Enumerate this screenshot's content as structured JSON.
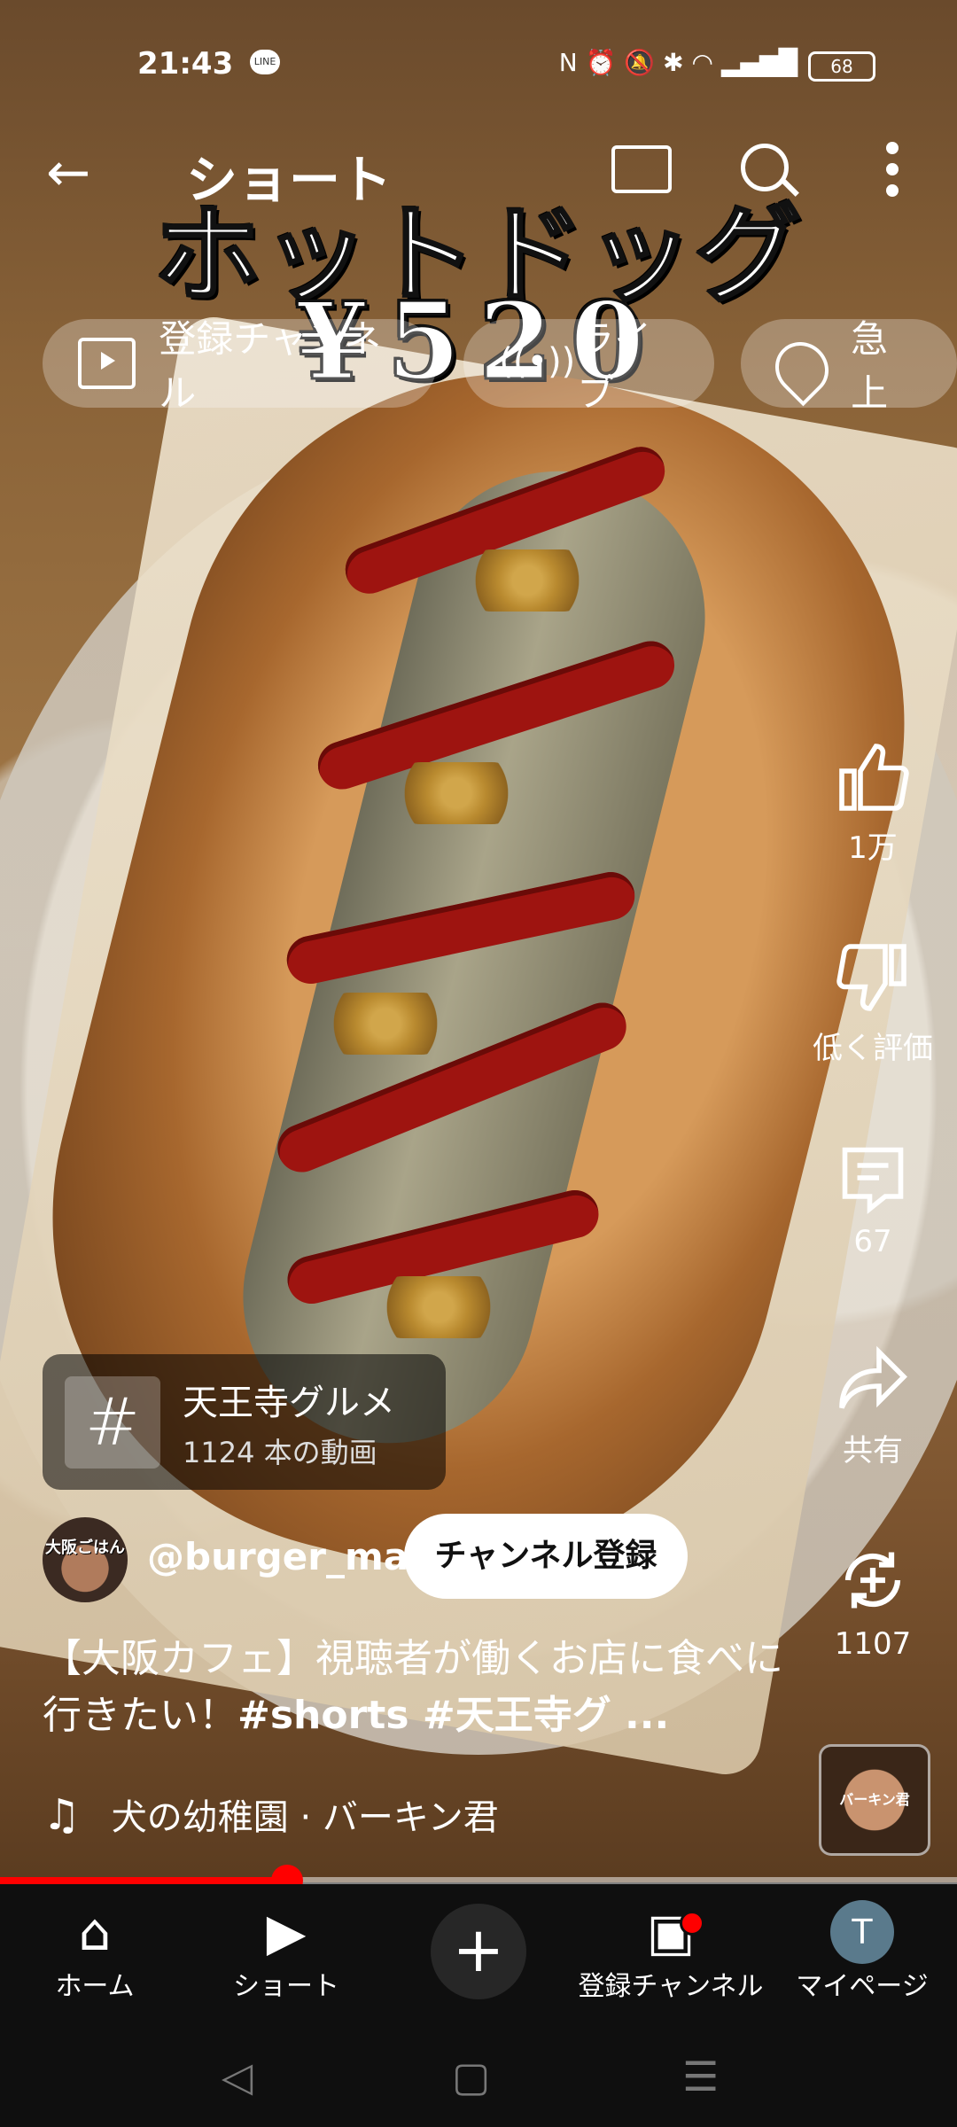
{
  "status": {
    "time": "21:43",
    "line_badge": "LINE",
    "battery": "68"
  },
  "appbar": {
    "title": "ショート"
  },
  "overlay": {
    "line1": "ホットドッグ",
    "line2": "¥520"
  },
  "chips": [
    {
      "label": "登録チャンネル",
      "icon": "subscriptions-icon"
    },
    {
      "label": "ライブ",
      "icon": "live-icon"
    },
    {
      "label": "急上",
      "icon": "trending-icon"
    }
  ],
  "actions": {
    "like": "1万",
    "dislike": "低く評価",
    "comments": "67",
    "share": "共有",
    "remix": "1107"
  },
  "hashtag": {
    "symbol": "#",
    "name": "天王寺グルメ",
    "count": "1124 本の動画"
  },
  "channel": {
    "avatar_text": "大阪ごはん",
    "handle": "@burger_man",
    "subscribe": "チャンネル登録"
  },
  "description": {
    "text": "【大阪カフェ】視聴者が働くお店に食べに行きたい！",
    "tags": "#shorts #天王寺グ ..."
  },
  "music": {
    "text": "犬の幼稚園 · バーキン君"
  },
  "sound_thumb": {
    "text": "バーキン君"
  },
  "progress": {
    "fraction": 0.3
  },
  "bottom_nav": {
    "home": "ホーム",
    "shorts": "ショート",
    "subs": "登録チャンネル",
    "mypage": "マイページ",
    "profile_initial": "T"
  },
  "colors": {
    "accent": "#ff0000",
    "nav_bg": "#0f0f0f"
  }
}
